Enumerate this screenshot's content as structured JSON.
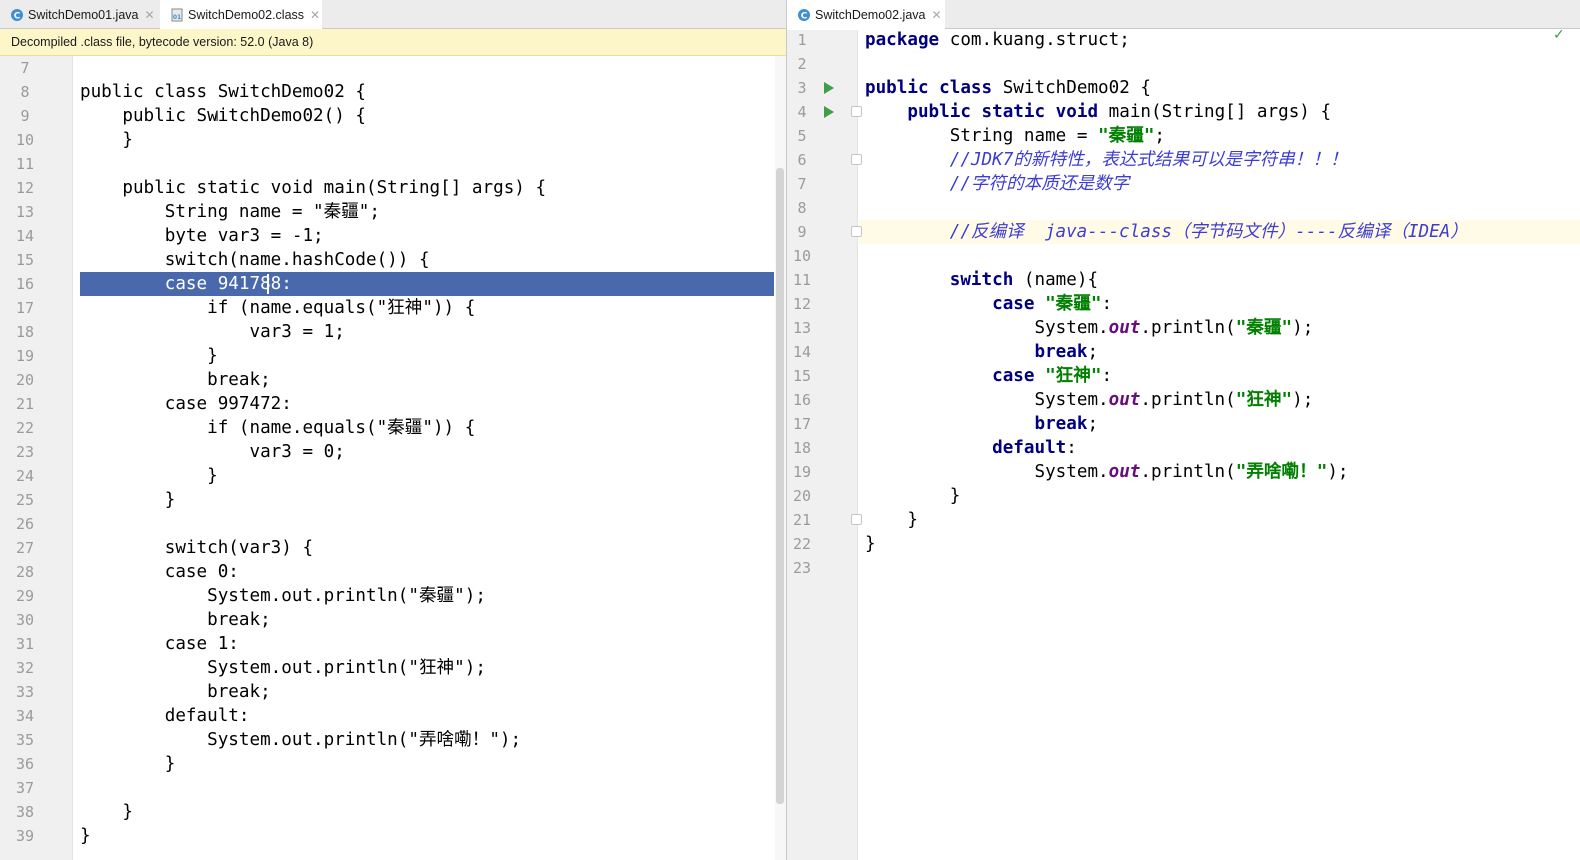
{
  "left_editor": {
    "tabs": [
      {
        "label": "SwitchDemo01.java",
        "icon": "java-class-icon",
        "active": false
      },
      {
        "label": "SwitchDemo02.class",
        "icon": "bytecode-file-icon",
        "active": true
      }
    ],
    "banner": "Decompiled .class file, bytecode version: 52.0 (Java 8)",
    "lines": [
      {
        "n": "7",
        "code": ""
      },
      {
        "n": "8",
        "code": "public class SwitchDemo02 {"
      },
      {
        "n": "9",
        "code": "    public SwitchDemo02() {"
      },
      {
        "n": "10",
        "code": "    }"
      },
      {
        "n": "11",
        "code": ""
      },
      {
        "n": "12",
        "code": "    public static void main(String[] args) {"
      },
      {
        "n": "13",
        "code": "        String name = \"秦疆\";"
      },
      {
        "n": "14",
        "code": "        byte var3 = -1;"
      },
      {
        "n": "15",
        "code": "        switch(name.hashCode()) {"
      },
      {
        "n": "16",
        "code": "        case 941788:"
      },
      {
        "n": "17",
        "code": "            if (name.equals(\"狂神\")) {"
      },
      {
        "n": "18",
        "code": "                var3 = 1;"
      },
      {
        "n": "19",
        "code": "            }"
      },
      {
        "n": "20",
        "code": "            break;"
      },
      {
        "n": "21",
        "code": "        case 997472:"
      },
      {
        "n": "22",
        "code": "            if (name.equals(\"秦疆\")) {"
      },
      {
        "n": "23",
        "code": "                var3 = 0;"
      },
      {
        "n": "24",
        "code": "            }"
      },
      {
        "n": "25",
        "code": "        }"
      },
      {
        "n": "26",
        "code": ""
      },
      {
        "n": "27",
        "code": "        switch(var3) {"
      },
      {
        "n": "28",
        "code": "        case 0:"
      },
      {
        "n": "29",
        "code": "            System.out.println(\"秦疆\");"
      },
      {
        "n": "30",
        "code": "            break;"
      },
      {
        "n": "31",
        "code": "        case 1:"
      },
      {
        "n": "32",
        "code": "            System.out.println(\"狂神\");"
      },
      {
        "n": "33",
        "code": "            break;"
      },
      {
        "n": "34",
        "code": "        default:"
      },
      {
        "n": "35",
        "code": "            System.out.println(\"弄啥嘞！\");"
      },
      {
        "n": "36",
        "code": "        }"
      },
      {
        "n": "37",
        "code": ""
      },
      {
        "n": "38",
        "code": "    }"
      },
      {
        "n": "39",
        "code": "}"
      }
    ],
    "selected_line": "16"
  },
  "right_editor": {
    "tabs": [
      {
        "label": "SwitchDemo02.java",
        "icon": "java-class-icon",
        "active": true
      }
    ],
    "current_line": "9",
    "lines": [
      {
        "n": "1",
        "tokens": [
          {
            "t": "package",
            "c": "kw"
          },
          {
            "t": " com.kuang.struct;"
          }
        ]
      },
      {
        "n": "2",
        "tokens": []
      },
      {
        "n": "3",
        "run": true,
        "tokens": [
          {
            "t": "public class",
            "c": "kw"
          },
          {
            "t": " SwitchDemo02 {"
          }
        ]
      },
      {
        "n": "4",
        "run": true,
        "fold": true,
        "tokens": [
          {
            "t": "    "
          },
          {
            "t": "public static void",
            "c": "kw"
          },
          {
            "t": " main(String[] args) {"
          }
        ]
      },
      {
        "n": "5",
        "tokens": [
          {
            "t": "        String name = "
          },
          {
            "t": "\"秦疆\"",
            "c": "str"
          },
          {
            "t": ";"
          }
        ]
      },
      {
        "n": "6",
        "fold": true,
        "tokens": [
          {
            "t": "        //JDK7的新特性，表达式结果可以是字符串！！！",
            "c": "cmt"
          }
        ]
      },
      {
        "n": "7",
        "tokens": [
          {
            "t": "        //字符的本质还是数字",
            "c": "cmt"
          }
        ]
      },
      {
        "n": "8",
        "tokens": []
      },
      {
        "n": "9",
        "fold": true,
        "tokens": [
          {
            "t": "        //反编译  java---class（字节码文件）----反编译（IDEA）",
            "c": "cmt"
          }
        ]
      },
      {
        "n": "10",
        "tokens": []
      },
      {
        "n": "11",
        "tokens": [
          {
            "t": "        "
          },
          {
            "t": "switch",
            "c": "kw"
          },
          {
            "t": " (name){"
          }
        ]
      },
      {
        "n": "12",
        "tokens": [
          {
            "t": "            "
          },
          {
            "t": "case",
            "c": "kw"
          },
          {
            "t": " "
          },
          {
            "t": "\"秦疆\"",
            "c": "str"
          },
          {
            "t": ":"
          }
        ]
      },
      {
        "n": "13",
        "tokens": [
          {
            "t": "                System."
          },
          {
            "t": "out",
            "c": "fld"
          },
          {
            "t": ".println("
          },
          {
            "t": "\"秦疆\"",
            "c": "str"
          },
          {
            "t": ");"
          }
        ]
      },
      {
        "n": "14",
        "tokens": [
          {
            "t": "                "
          },
          {
            "t": "break",
            "c": "kw"
          },
          {
            "t": ";"
          }
        ]
      },
      {
        "n": "15",
        "tokens": [
          {
            "t": "            "
          },
          {
            "t": "case",
            "c": "kw"
          },
          {
            "t": " "
          },
          {
            "t": "\"狂神\"",
            "c": "str"
          },
          {
            "t": ":"
          }
        ]
      },
      {
        "n": "16",
        "tokens": [
          {
            "t": "                System."
          },
          {
            "t": "out",
            "c": "fld"
          },
          {
            "t": ".println("
          },
          {
            "t": "\"狂神\"",
            "c": "str"
          },
          {
            "t": ");"
          }
        ]
      },
      {
        "n": "17",
        "tokens": [
          {
            "t": "                "
          },
          {
            "t": "break",
            "c": "kw"
          },
          {
            "t": ";"
          }
        ]
      },
      {
        "n": "18",
        "tokens": [
          {
            "t": "            "
          },
          {
            "t": "default",
            "c": "kw"
          },
          {
            "t": ":"
          }
        ]
      },
      {
        "n": "19",
        "tokens": [
          {
            "t": "                System."
          },
          {
            "t": "out",
            "c": "fld"
          },
          {
            "t": ".println("
          },
          {
            "t": "\"弄啥嘞！\"",
            "c": "str"
          },
          {
            "t": ");"
          }
        ]
      },
      {
        "n": "20",
        "tokens": [
          {
            "t": "        }"
          }
        ]
      },
      {
        "n": "21",
        "fold": true,
        "tokens": [
          {
            "t": "    }"
          }
        ]
      },
      {
        "n": "22",
        "tokens": [
          {
            "t": "}"
          }
        ]
      },
      {
        "n": "23",
        "tokens": []
      }
    ]
  },
  "colors": {
    "keyword": "#000080",
    "string": "#008000",
    "comment": "#3d3dd6",
    "static_field": "#660e7a",
    "selection": "#4a69ad",
    "banner": "#fdf6c8",
    "run_gutter": "#3f9c48"
  }
}
